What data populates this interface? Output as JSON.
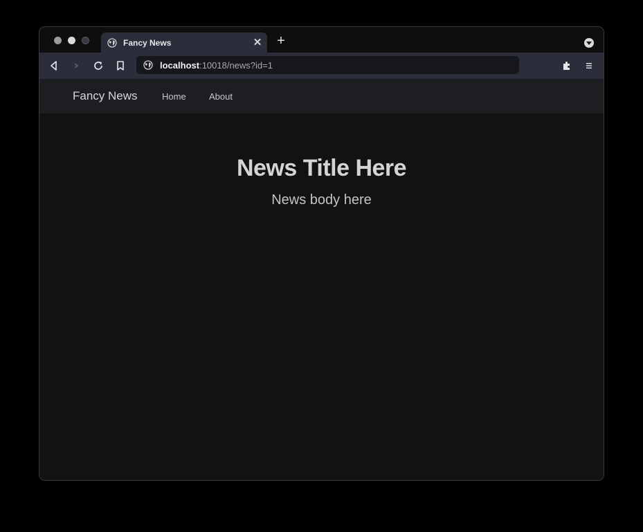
{
  "browser": {
    "tab": {
      "title": "Fancy News",
      "icon": "globe-icon",
      "close_glyph": "✕"
    },
    "new_tab_glyph": "+",
    "address": {
      "host": "localhost",
      "rest": ":10018/news?id=1"
    },
    "colors": {
      "tab_active": "#2b2d3a",
      "toolbar": "#2b2d3a",
      "tabstrip": "#0e0e0f"
    }
  },
  "site": {
    "brand": "Fancy News",
    "nav": {
      "home": "Home",
      "about": "About"
    },
    "colors": {
      "navbar": "#1d1e22",
      "background": "#121212"
    }
  },
  "article": {
    "title": "News Title Here",
    "body": "News body here"
  }
}
